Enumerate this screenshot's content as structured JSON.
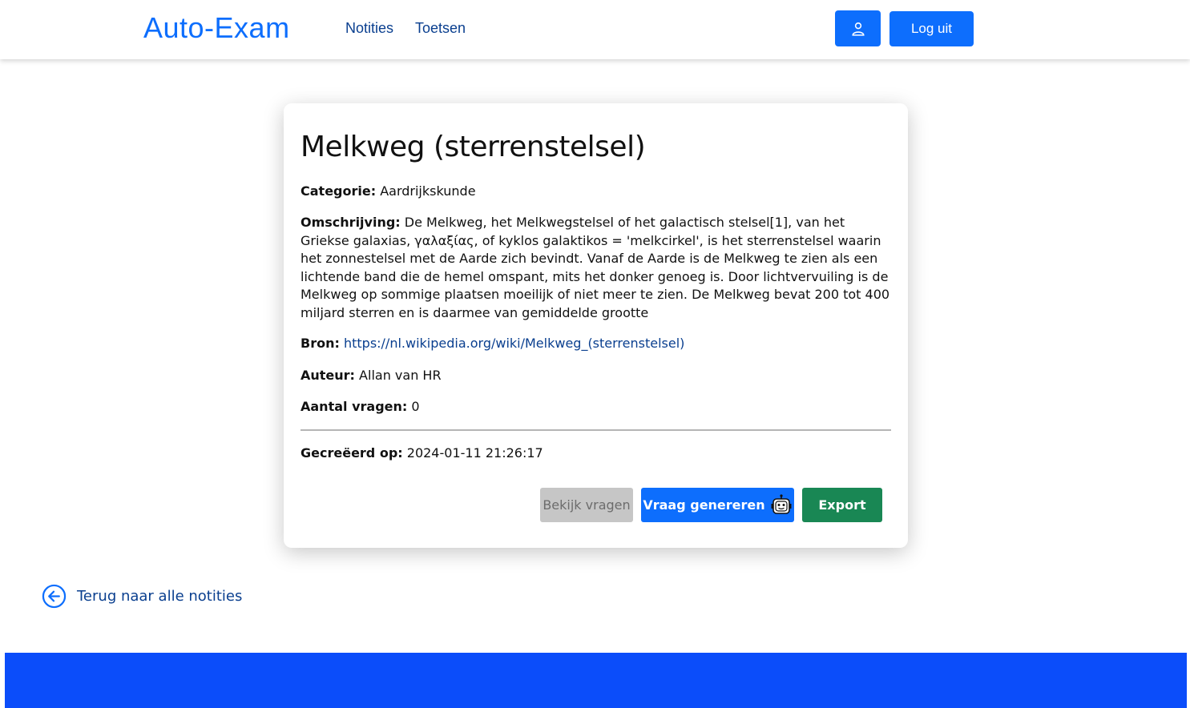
{
  "nav": {
    "brand": "Auto-Exam",
    "links": [
      "Notities",
      "Toetsen"
    ],
    "user_icon": "user-icon",
    "logout_label": "Log uit"
  },
  "note": {
    "title": "Melkweg (sterrenstelsel)",
    "category_label": "Categorie:",
    "category": "Aardrijkskunde",
    "description_label": "Omschrijving:",
    "description": "De Melkweg, het Melkwegstelsel of het galactisch stelsel[1], van het Griekse galaxias, γαλαξίας, of kyklos galaktikos = 'melkcirkel', is het sterrenstelsel waarin het zonnestelsel met de Aarde zich bevindt. Vanaf de Aarde is de Melkweg te zien als een lichtende band die de hemel omspant, mits het donker genoeg is. Door lichtvervuiling is de Melkweg op sommige plaatsen moeilijk of niet meer te zien. De Melkweg bevat 200 tot 400 miljard sterren en is daarmee van gemiddelde grootte",
    "source_label": "Bron:",
    "source": "https://nl.wikipedia.org/wiki/Melkweg_(sterrenstelsel)",
    "author_label": "Auteur:",
    "author": "Allan van HR",
    "questions_label": "Aantal vragen:",
    "questions": "0",
    "created_label": "Gecreëerd op:",
    "created": "2024-01-11 21:26:17"
  },
  "actions": {
    "view_label": "Bekijk vragen",
    "generate_label": "Vraag genereren",
    "generate_icon": "robot-icon",
    "export_label": "Export"
  },
  "back": {
    "icon": "arrow-left-circle-icon",
    "label": "Terug naar alle notities"
  },
  "colors": {
    "primary": "#0d6efd",
    "success": "#198754",
    "footer": "#0b4dfa",
    "link": "#0a3f8f",
    "disabled": "#c6c6c6"
  }
}
